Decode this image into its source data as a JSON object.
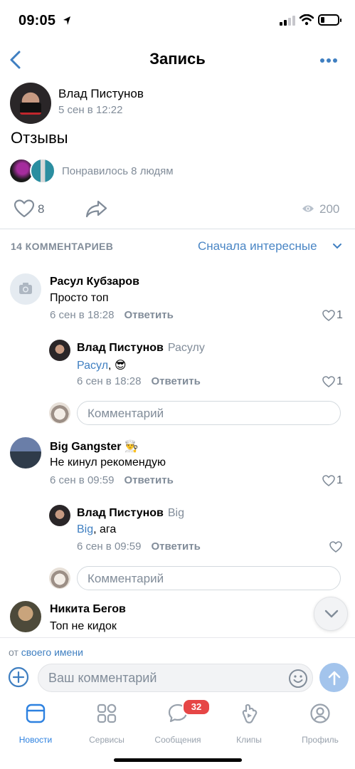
{
  "status_bar": {
    "time": "09:05"
  },
  "nav": {
    "title": "Запись"
  },
  "post": {
    "author": "Влад Пистунов",
    "date": "5 сен в 12:22",
    "text": "Отзывы",
    "liked_by_text": "Понравилось 8 людям",
    "likes": "8",
    "views": "200"
  },
  "comments_header": {
    "count_label": "14 КОММЕНТАРИЕВ",
    "sort_label": "Сначала интересные"
  },
  "comments": [
    {
      "author": "Расул Кубзаров",
      "text": "Просто топ",
      "date": "6 сен в 18:28",
      "reply_label": "Ответить",
      "likes": "1",
      "reply": {
        "author": "Влад Пистунов",
        "reply_to": "Расулу",
        "mention": "Расул",
        "text": ", 😎",
        "date": "6 сен в 18:28",
        "reply_label": "Ответить",
        "likes": "1"
      },
      "input_placeholder": "Комментарий"
    },
    {
      "author": "Big Gangster",
      "author_emoji": "👨‍🍳",
      "text": "Не кинул рекомендую",
      "date": "6 сен в 09:59",
      "reply_label": "Ответить",
      "likes": "1",
      "reply": {
        "author": "Влад Пистунов",
        "reply_to": "Big",
        "mention": "Big",
        "text": ", ага",
        "date": "6 сен в 09:59",
        "reply_label": "Ответить",
        "likes": ""
      },
      "input_placeholder": "Комментарий"
    },
    {
      "author": "Никита Бегов",
      "text": "Топ не кидок"
    }
  ],
  "reply_bar": {
    "from_prefix": "от",
    "from_name": "своего имени",
    "placeholder": "Ваш комментарий"
  },
  "tabs": [
    {
      "label": "Новости",
      "icon": "news-icon"
    },
    {
      "label": "Сервисы",
      "icon": "services-icon"
    },
    {
      "label": "Сообщения",
      "icon": "messages-icon",
      "badge": "32"
    },
    {
      "label": "Клипы",
      "icon": "clips-icon"
    },
    {
      "label": "Профиль",
      "icon": "profile-icon"
    }
  ],
  "colors": {
    "accent": "#2d81e0",
    "link": "#3f7fc1",
    "secondary_text": "#818c99",
    "badge": "#e64646"
  }
}
